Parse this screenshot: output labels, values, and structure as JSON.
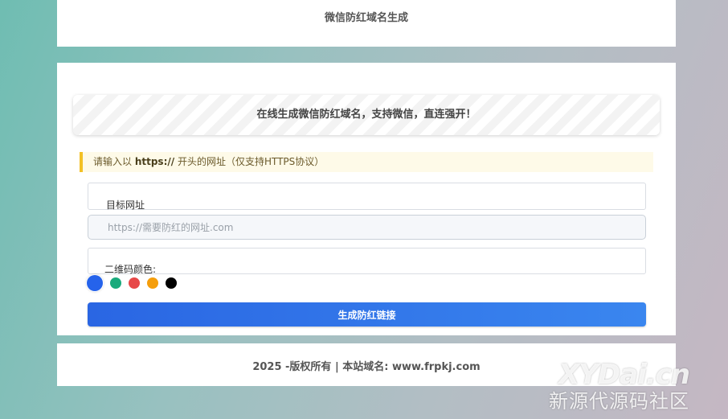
{
  "header": {
    "title": "微信防红域名生成"
  },
  "banner": {
    "text": "在线生成微信防红域名，支持微信，直连强开！"
  },
  "notice": {
    "prefix": "请输入以 ",
    "highlight": "https://",
    "suffix": " 开头的网址（仅支持HTTPS协议）"
  },
  "form": {
    "target_label": "目标网址",
    "url_placeholder": "https://需要防红的网址.com",
    "url_value": "",
    "color_label": "二维码颜色:",
    "colors": [
      {
        "name": "blue",
        "hex": "#2563eb",
        "selected": true
      },
      {
        "name": "green",
        "hex": "#1aaa7c",
        "selected": false
      },
      {
        "name": "red",
        "hex": "#e74848",
        "selected": false
      },
      {
        "name": "orange",
        "hex": "#f59e0b",
        "selected": false
      },
      {
        "name": "black",
        "hex": "#000000",
        "selected": false
      }
    ],
    "submit_label": "生成防红链接"
  },
  "footer": {
    "text": "2025 -版权所有 | 本站域名: www.frpkj.com"
  },
  "watermark": {
    "main": "XYDai.cn",
    "sub": "新源代源码社区"
  },
  "theme": {
    "accent": "#2a66e3",
    "notice_border": "#f3c125",
    "notice_bg": "#fefae8"
  }
}
